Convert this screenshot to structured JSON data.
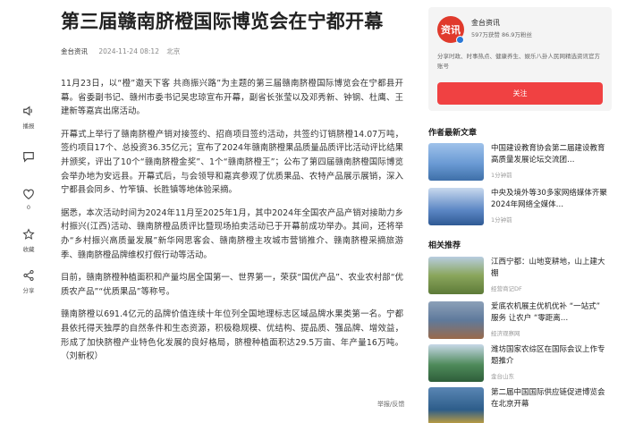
{
  "article": {
    "title": "第三届赣南脐橙国际博览会在宁都开幕",
    "source": "金台资讯",
    "time": "2024-11-24 08:12",
    "location": "北京",
    "paragraphs": [
      "11月23日，以“橙”邀天下客 共商振兴路”为主题的第三届赣南脐橙国际博览会在宁都县开幕。省委副书记、赣州市委书记吴忠琼宣布开幕，副省长张莹以及邓秀新、钟钢、杜鹰、王建新等嘉宾出席活动。",
      "开幕式上举行了赣南脐橙产销对接签约、招商项目签约活动，共签约订销脐橙14.07万吨，签约项目17个、总投资36.35亿元；宣布了2024年赣南脐橙果品质量品质评比活动评比结果并颁奖，评出了10个“赣南脐橙金奖”、1个“赣南脐橙王”；公布了第四届赣南脐橙国际博览会举办地为安远县。开幕式后，与会领导和嘉宾参观了优质果品、农特产品展示展销，深入宁都县会同乡、竹笮镇、长胜镇等地体验采摘。",
      "据悉，本次活动时间为2024年11月至2025年1月，其中2024年全国农产品产销对接助力乡村振兴(江西)活动、赣南脐橙品质评比暨现场拍卖活动已于开幕前成功举办。其间，还将举办“乡村振兴高质量发展”新华网思客会、赣南脐橙主攻城市营销推介、赣南脐橙采摘旅游季、赣南脐橙品牌维权打假行动等活动。",
      "目前，赣南脐橙种植面积和产量均居全国第一、世界第一，荣获“国优产品”、农业农村部“优质农产品”“优质果品”等称号。",
      "赣南脐橙以691.4亿元的品牌价值连续十年位列全国地理标志区域品牌水果类第一名。宁都县依托得天独厚的自然条件和生态资源，积极稳规模、优结构、提品质、强品牌、增效益，形成了加快脐橙产业特色化发展的良好格局，脐橙种植面积达29.5万亩、年产量16万吨。（刘新权）"
    ],
    "report_label": "举报/反馈"
  },
  "actions": [
    {
      "icon": "sound-icon",
      "label": "播报"
    },
    {
      "icon": "comment-icon",
      "label": ""
    },
    {
      "icon": "like-icon",
      "label": "0"
    },
    {
      "icon": "star-icon",
      "label": "收藏"
    },
    {
      "icon": "share-icon",
      "label": "分享"
    }
  ],
  "author": {
    "avatar_text": "资讯",
    "name": "金台资讯",
    "stats": "597万获赞 86.9万粉丝",
    "desc": "分享时政、时事热点、健康养生、娱乐八卦人民网精选资讯官方账号",
    "follow_label": "关注"
  },
  "latest": {
    "heading": "作者最新文章",
    "items": [
      {
        "title": "中国建设教育协会第二届建设教育高质量发展论坛交流团…",
        "meta": "1分钟前",
        "thumb": "#6a9ad4"
      },
      {
        "title": "中央及境外等30多家网络媒体齐聚 2024年网络全媒体…",
        "meta": "1分钟前",
        "thumb": "#5b86c4"
      }
    ]
  },
  "related": {
    "heading": "相关推荐",
    "items": [
      {
        "title": "江西宁都：山地变耕地，山上建大棚",
        "meta": "经营商记DF",
        "thumb": "#8aa65c"
      },
      {
        "title": "爱底农机展主优机优补 “一站式” 服务 让农户 “零距离…",
        "meta": "经济观察网",
        "thumb": "#5f7a9c"
      },
      {
        "title": "潍坊国家农综区在国际会议上作专题推介",
        "meta": "金台山东",
        "thumb": "#4e8a5a"
      },
      {
        "title": "第二届中国国际供应链促进博览会在北京开幕",
        "meta": "",
        "thumb": "#2d5d8a"
      }
    ]
  },
  "colors": {
    "accent": "#f04142",
    "avatar": "#e03a2c",
    "verified": "#2a78d6"
  }
}
